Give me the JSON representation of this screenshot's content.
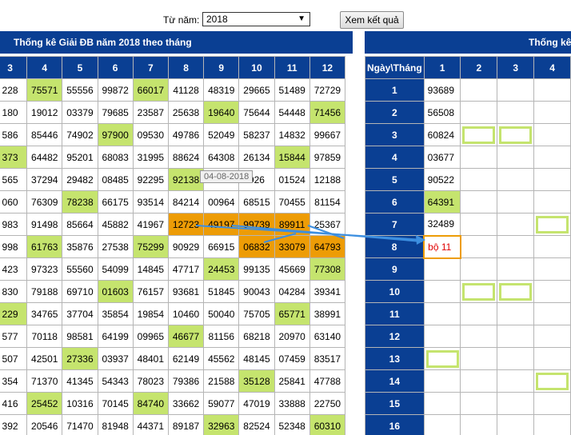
{
  "controls": {
    "from_year_label": "Từ năm:",
    "year_value": "2018",
    "view_button": "Xem kết quả"
  },
  "left_panel": {
    "title": "Thống kê Giải ĐB năm 2018 theo tháng",
    "headers": [
      "3",
      "4",
      "5",
      "6",
      "7",
      "8",
      "9",
      "10",
      "11",
      "12"
    ],
    "rows": [
      [
        "228",
        "75571",
        "55556",
        "99872",
        "66017",
        "41128",
        "48319",
        "29665",
        "51489",
        "72729"
      ],
      [
        "180",
        "19012",
        "03379",
        "79685",
        "23587",
        "25638",
        "19640",
        "75644",
        "54448",
        "71456"
      ],
      [
        "586",
        "85446",
        "74902",
        "97900",
        "09530",
        "49786",
        "52049",
        "58237",
        "14832",
        "99667"
      ],
      [
        "373",
        "64482",
        "95201",
        "68083",
        "31995",
        "88624",
        "64308",
        "26134",
        "15844",
        "97859"
      ],
      [
        "565",
        "37294",
        "29482",
        "08485",
        "92295",
        "92138",
        "",
        "926",
        "01524",
        "12188"
      ],
      [
        "060",
        "76309",
        "78238",
        "66175",
        "93514",
        "84214",
        "00964",
        "68515",
        "70455",
        "81154"
      ],
      [
        "983",
        "91498",
        "85664",
        "45882",
        "41967",
        "12723",
        "49197",
        "99739",
        "89911",
        "25367"
      ],
      [
        "998",
        "61763",
        "35876",
        "27538",
        "75299",
        "90929",
        "66915",
        "06832",
        "33079",
        "64793"
      ],
      [
        "423",
        "97323",
        "55560",
        "54099",
        "14845",
        "47717",
        "24453",
        "99135",
        "45669",
        "77308"
      ],
      [
        "830",
        "79188",
        "69710",
        "01603",
        "76157",
        "93681",
        "51845",
        "90043",
        "04284",
        "39341"
      ],
      [
        "229",
        "34765",
        "37704",
        "35854",
        "19854",
        "10460",
        "50040",
        "75705",
        "65771",
        "38991"
      ],
      [
        "577",
        "70118",
        "98581",
        "64199",
        "09965",
        "46677",
        "81156",
        "68218",
        "20970",
        "63140"
      ],
      [
        "507",
        "42501",
        "27336",
        "03937",
        "48401",
        "62149",
        "45562",
        "48145",
        "07459",
        "83517"
      ],
      [
        "354",
        "71370",
        "41345",
        "54343",
        "78023",
        "79386",
        "21588",
        "35128",
        "25841",
        "47788"
      ],
      [
        "416",
        "25452",
        "10316",
        "70145",
        "84740",
        "33662",
        "59077",
        "47019",
        "33888",
        "22750"
      ],
      [
        "392",
        "20546",
        "71470",
        "81948",
        "44371",
        "89187",
        "32963",
        "82524",
        "52348",
        "60310"
      ]
    ],
    "tooltip": "04-08-2018"
  },
  "right_panel": {
    "title": "Thống kê",
    "corner_header": "Ngày\\Tháng",
    "month_headers": [
      "1",
      "2",
      "3",
      "4"
    ],
    "rows": [
      {
        "day": "1",
        "cells": [
          "93689",
          "",
          "",
          ""
        ]
      },
      {
        "day": "2",
        "cells": [
          "56508",
          "",
          "",
          ""
        ]
      },
      {
        "day": "3",
        "cells": [
          "60824",
          "",
          "",
          ""
        ]
      },
      {
        "day": "4",
        "cells": [
          "03677",
          "",
          "",
          ""
        ]
      },
      {
        "day": "5",
        "cells": [
          "90522",
          "",
          "",
          ""
        ]
      },
      {
        "day": "6",
        "cells": [
          "64391",
          "",
          "",
          ""
        ]
      },
      {
        "day": "7",
        "cells": [
          "32489",
          "",
          "",
          ""
        ]
      },
      {
        "day": "8",
        "cells": [
          "bộ 11",
          "",
          "",
          ""
        ]
      },
      {
        "day": "9",
        "cells": [
          "",
          "",
          "",
          ""
        ]
      },
      {
        "day": "10",
        "cells": [
          "",
          "",
          "",
          ""
        ]
      },
      {
        "day": "11",
        "cells": [
          "",
          "",
          "",
          ""
        ]
      },
      {
        "day": "12",
        "cells": [
          "",
          "",
          "",
          ""
        ]
      },
      {
        "day": "13",
        "cells": [
          "",
          "",
          "",
          ""
        ]
      },
      {
        "day": "14",
        "cells": [
          "",
          "",
          "",
          ""
        ]
      },
      {
        "day": "15",
        "cells": [
          "",
          "",
          "",
          ""
        ]
      },
      {
        "day": "16",
        "cells": [
          "",
          "",
          "",
          ""
        ]
      }
    ]
  },
  "colors": {
    "header_blue": "#0a3f93",
    "highlight_green": "#c5e46e",
    "highlight_orange": "#ed9c06",
    "arrow_blue": "#3d8fe0",
    "text_red": "#e00000"
  }
}
